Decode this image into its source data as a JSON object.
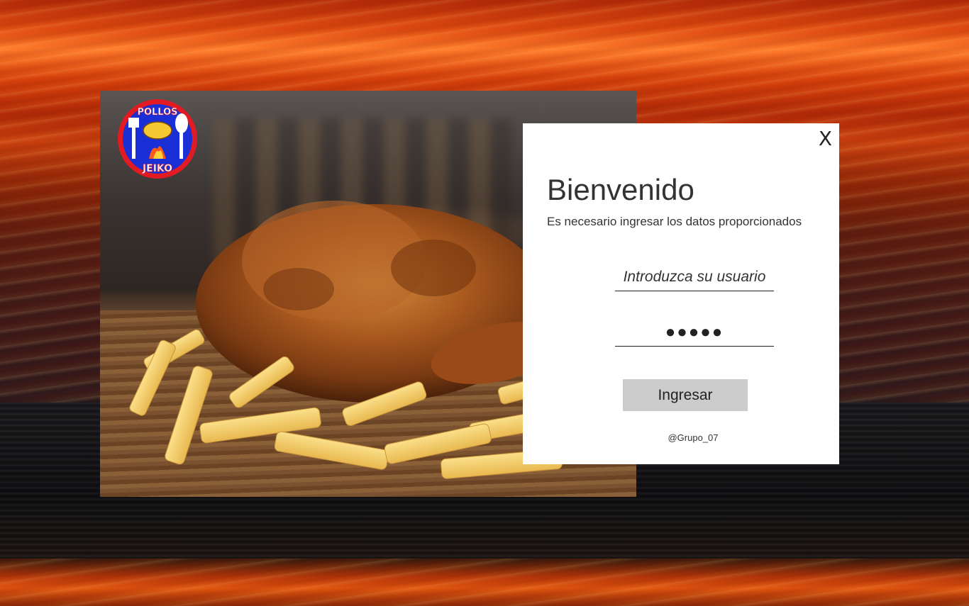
{
  "window": {
    "close_label": "X"
  },
  "login": {
    "title": "Bienvenido",
    "subtitle": "Es necesario ingresar los datos proporcionados",
    "username_placeholder": "Introduzca su usuario",
    "password_value": "●●●●●",
    "submit_label": "Ingresar",
    "credit": "@Grupo_07"
  },
  "brand": {
    "logo_text_top": "POLLOS",
    "logo_text_bottom": "JEIKO"
  },
  "colors": {
    "logo_ring": "#e21b23",
    "logo_fill": "#1a2fd6",
    "button_bg": "#cccccc"
  },
  "icons": {
    "close": "close-icon",
    "logo": "pollos-jeiko-logo"
  }
}
